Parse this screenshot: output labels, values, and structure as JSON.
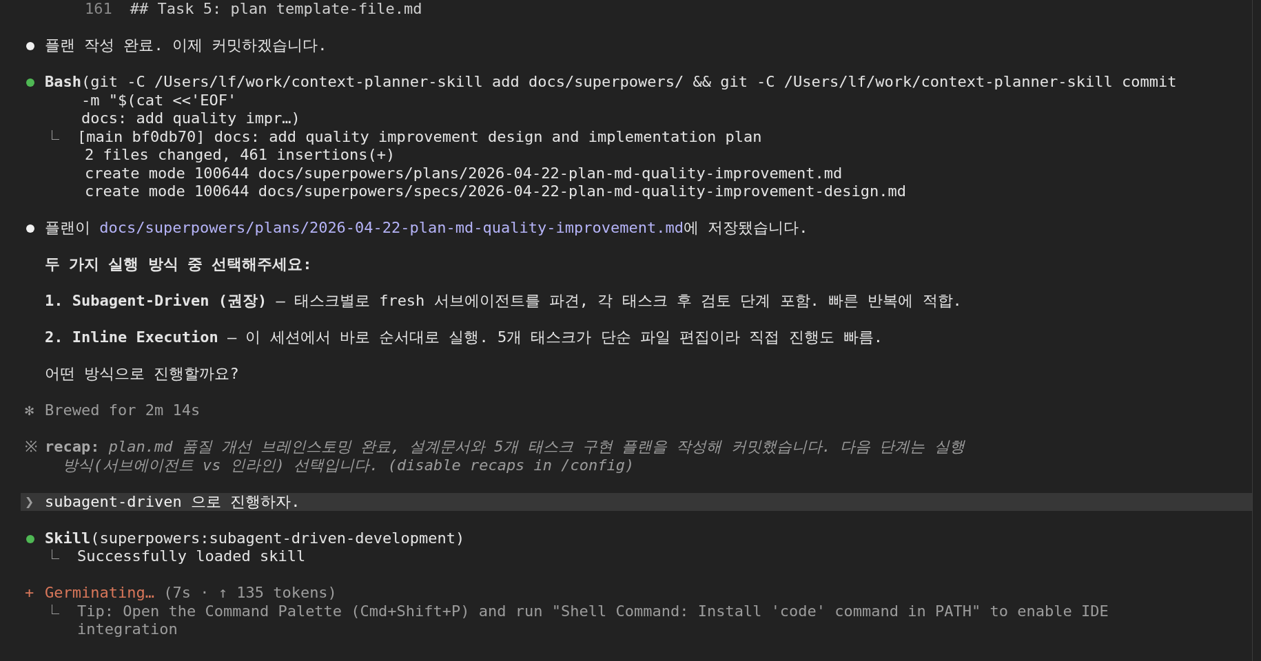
{
  "top_line": {
    "line_number": "161",
    "text": "## Task 5: plan template-file.md"
  },
  "blocks": [
    {
      "kind": "message",
      "paragraphs": [
        {
          "text": "플랜 작성 완료. 이제 커밋하겠습니다."
        }
      ]
    },
    {
      "kind": "tool",
      "command": "**Bash**(git -C /Users/lf/work/context-planner-skill add docs/superpowers/ && git -C /Users/lf/work/context-planner-skill commit\n-m \"$(cat <<'EOF'\ndocs: add quality impr…)",
      "output": [
        "[main bf0db70] docs: add quality improvement design and implementation plan",
        "2 files changed, 461 insertions(+)",
        "create mode 100644 docs/superpowers/plans/2026-04-22-plan-md-quality-improvement.md",
        "create mode 100644 docs/superpowers/specs/2026-04-22-plan-md-quality-improvement-design.md"
      ]
    },
    {
      "kind": "message",
      "paragraphs": [
        {
          "text": "플랜이 ",
          "link": "docs/superpowers/plans/2026-04-22-plan-md-quality-improvement.md",
          "text_after": "에 저장됐습니다."
        },
        {
          "text": "두 가지 실행 방식 중 선택해주세요:",
          "bold": true
        },
        {
          "text": "**1. Subagent-Driven (권장)** — 태스크별로 fresh 서브에이전트를 파견, 각 태스크 후 검토 단계 포함. 빠른 반복에 적합."
        },
        {
          "text": "**2. Inline Execution** — 이 세션에서 바로 순서대로 실행. 5개 태스크가 단순 파일 편집이라 직접 진행도 빠름."
        },
        {
          "text": "어떤 방식으로 진행할까요?"
        }
      ]
    },
    {
      "kind": "brewed",
      "icon": "✻",
      "text": "Brewed for 2m 14s"
    },
    {
      "kind": "recap",
      "icon": "※",
      "label": "recap:",
      "text": "plan.md 품질 개선 브레인스토밍 완료, 설계문서와 5개 태스크 구현 플랜을 작성해 커밋했습니다. 다음 단계는 실행\n방식(서브에이전트 vs 인라인) 선택입니다. (disable recaps in /config)"
    },
    {
      "kind": "prompt",
      "icon": "❯",
      "text": "subagent-driven 으로 진행하자."
    },
    {
      "kind": "tool",
      "command": "**Skill**(superpowers:subagent-driven-development)",
      "output": [
        "Successfully loaded skill"
      ]
    },
    {
      "kind": "status",
      "icon": "+",
      "label": "Germinating…",
      "detail": "(7s · ↑ 135 tokens)",
      "output": [
        "Tip: Open the Command Palette (Cmd+Shift+P) and run \"Shell Command: Install 'code' command in PATH\" to enable IDE\nintegration"
      ]
    }
  ]
}
